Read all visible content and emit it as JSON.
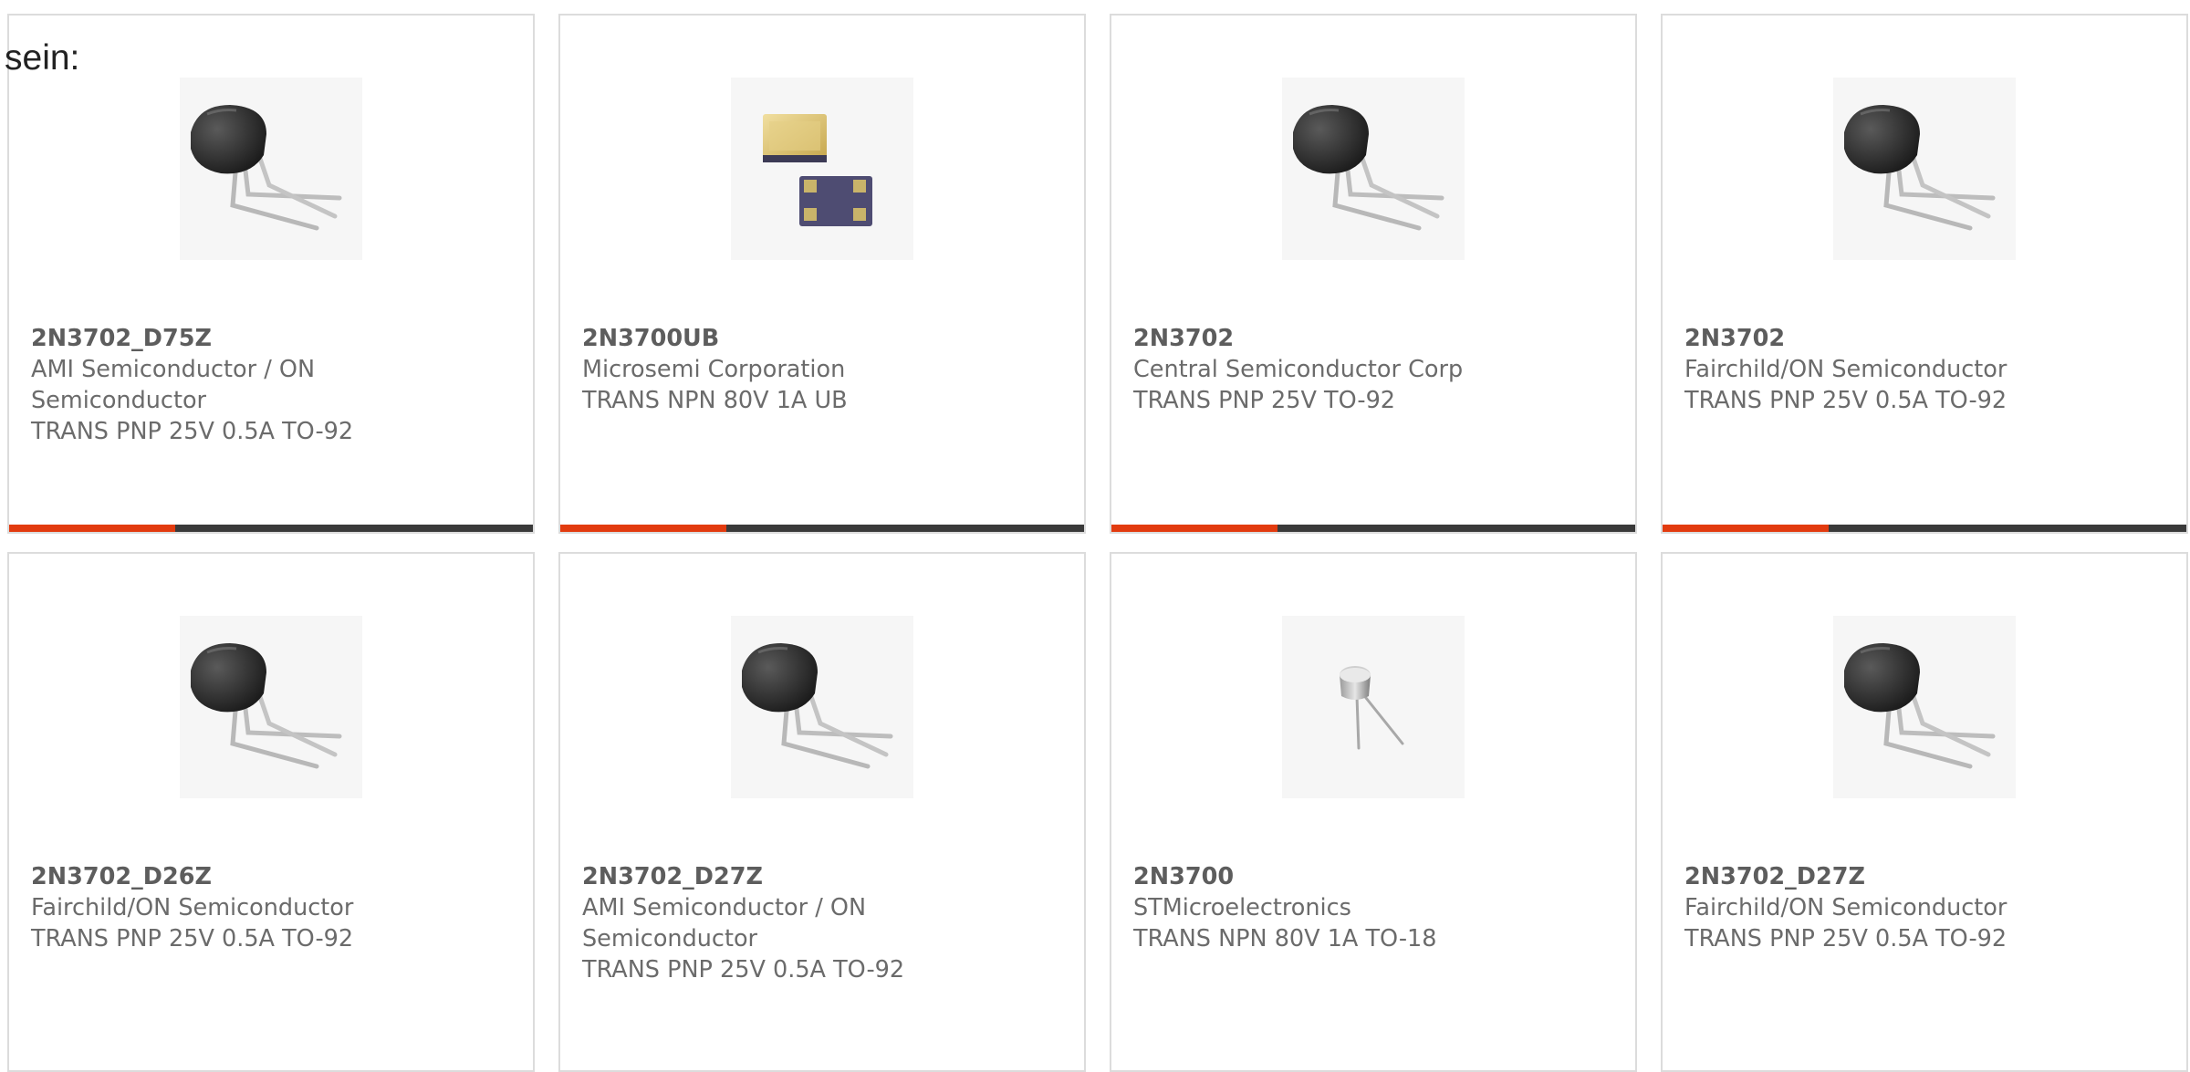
{
  "page": {
    "heading_fragment": "sein:"
  },
  "colors": {
    "accent": "#e23b0f",
    "bar": "#3a3a3a",
    "card_border": "#dcdcdc",
    "text": "#6b6b6b"
  },
  "products": [
    {
      "part": "2N3702_D75Z",
      "manufacturer": "AMI Semiconductor / ON Semiconductor",
      "description": "TRANS PNP 25V 0.5A TO-92",
      "icon": "to92-transistor-icon"
    },
    {
      "part": "2N3700UB",
      "manufacturer": "Microsemi Corporation",
      "description": "TRANS NPN 80V 1A UB",
      "icon": "smd-package-icon"
    },
    {
      "part": "2N3702",
      "manufacturer": "Central Semiconductor Corp",
      "description": "TRANS PNP 25V TO-92",
      "icon": "to92-transistor-icon"
    },
    {
      "part": "2N3702",
      "manufacturer": "Fairchild/ON Semiconductor",
      "description": "TRANS PNP 25V 0.5A TO-92",
      "icon": "to92-transistor-icon"
    },
    {
      "part": "2N3702_D26Z",
      "manufacturer": "Fairchild/ON Semiconductor",
      "description": "TRANS PNP 25V 0.5A TO-92",
      "icon": "to92-transistor-icon"
    },
    {
      "part": "2N3702_D27Z",
      "manufacturer": "AMI Semiconductor / ON Semiconductor",
      "description": "TRANS PNP 25V 0.5A TO-92",
      "icon": "to92-transistor-icon"
    },
    {
      "part": "2N3700",
      "manufacturer": "STMicroelectronics",
      "description": "TRANS NPN 80V 1A TO-18",
      "icon": "to18-transistor-icon"
    },
    {
      "part": "2N3702_D27Z",
      "manufacturer": "Fairchild/ON Semiconductor",
      "description": "TRANS PNP 25V 0.5A TO-92",
      "icon": "to92-transistor-icon"
    }
  ]
}
